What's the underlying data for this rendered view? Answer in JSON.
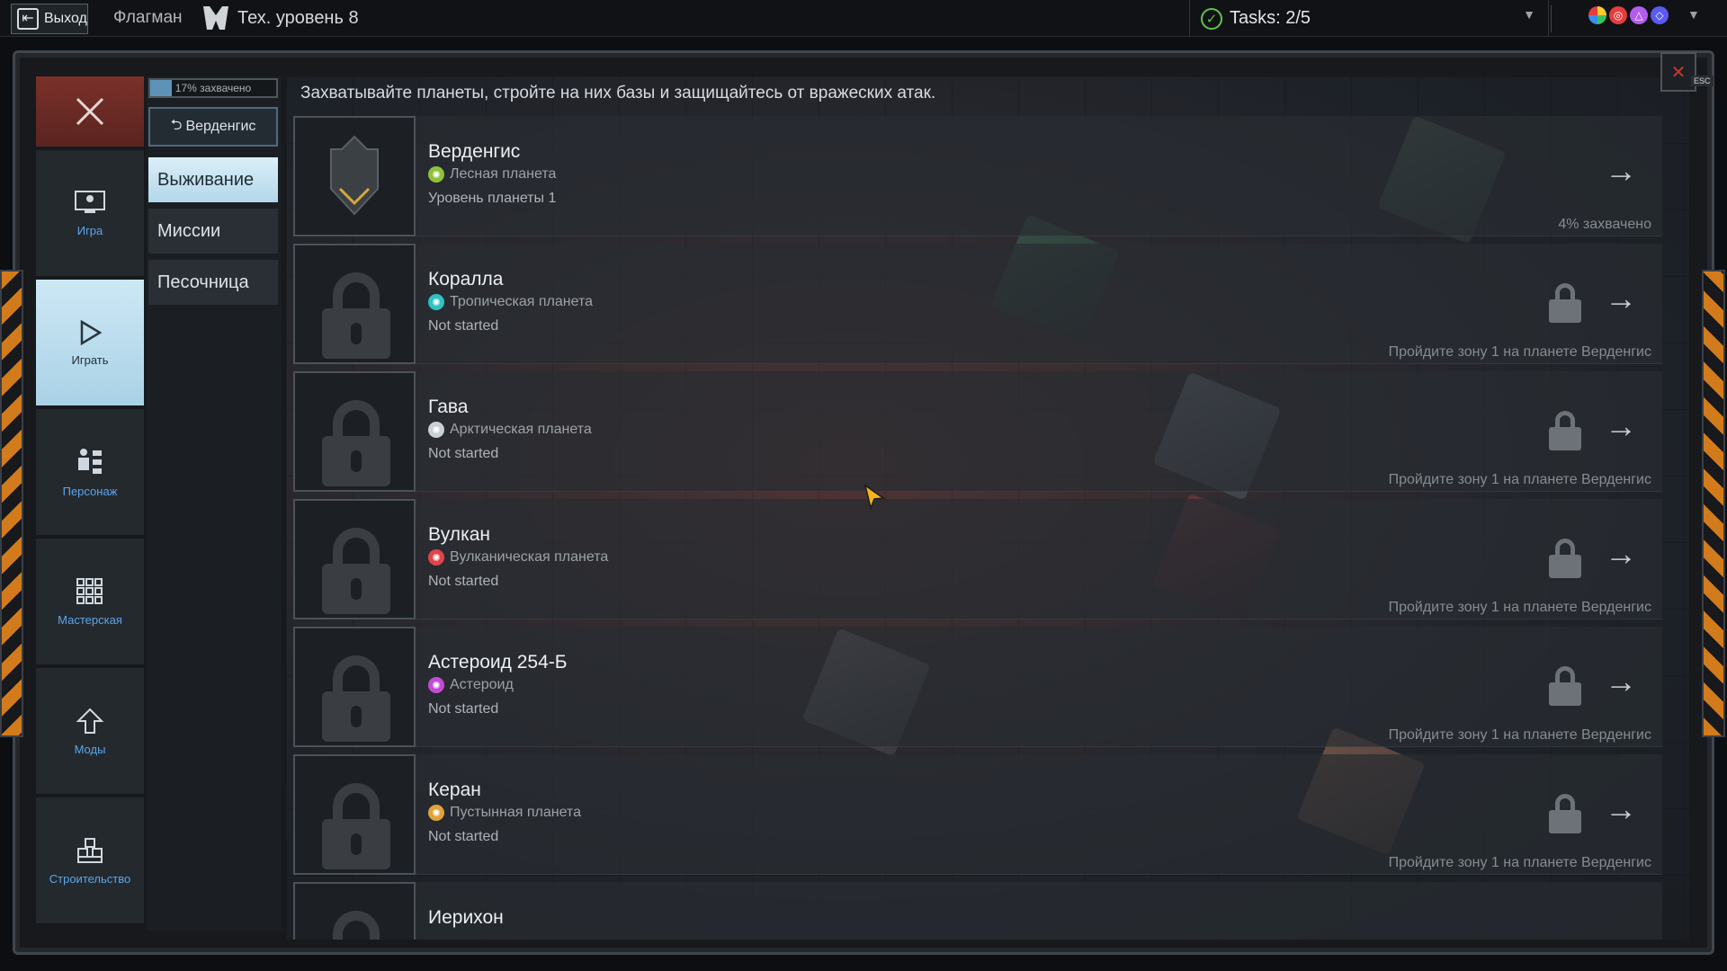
{
  "topbar": {
    "exit_label": "Выход",
    "flagship_label": "Флагман",
    "tech_level": "Тех. уровень 8",
    "tasks": "Tasks: 2/5",
    "resource_colors": [
      "#ffcc33",
      "#e43d3d",
      "#b45cf0",
      "#5a5af0"
    ]
  },
  "nav": {
    "items": [
      {
        "label": "Игра",
        "icon": "monitor-icon"
      },
      {
        "label": "Играть",
        "icon": "play-icon"
      },
      {
        "label": "Персонаж",
        "icon": "character-icon"
      },
      {
        "label": "Мастерская",
        "icon": "grid-icon"
      },
      {
        "label": "Моды",
        "icon": "arrow-up-icon"
      },
      {
        "label": "Строительство",
        "icon": "blocks-icon"
      }
    ],
    "active": "Играть"
  },
  "submenu": {
    "progress_label": "17% захвачено",
    "progress_fraction": 0.17,
    "planet_button": "Верденгис",
    "modes": [
      "Выживание",
      "Миссии",
      "Песочница"
    ],
    "active_mode": "Выживание"
  },
  "main": {
    "description": "Захватывайте планеты, стройте на них базы и защищайтесь от вражеских атак.",
    "planets": [
      {
        "name": "Верденгис",
        "type": "Лесная планета",
        "type_color": "#8fc23a",
        "status": "Уровень планеты 1",
        "note": "4% захвачено",
        "locked": false
      },
      {
        "name": "Коралла",
        "type": "Тропическая планета",
        "type_color": "#2fc2c0",
        "status": "Not started",
        "note": "Пройдите зону 1 на планете Верденгис",
        "locked": true
      },
      {
        "name": "Гава",
        "type": "Арктическая планета",
        "type_color": "#c9d1d6",
        "status": "Not started",
        "note": "Пройдите зону 1 на планете Верденгис",
        "locked": true
      },
      {
        "name": "Вулкан",
        "type": "Вулканическая планета",
        "type_color": "#e0454a",
        "status": "Not started",
        "note": "Пройдите зону 1 на планете Верденгис",
        "locked": true
      },
      {
        "name": "Астероид 254-Б",
        "type": "Астероид",
        "type_color": "#c24cd3",
        "status": "Not started",
        "note": "Пройдите зону 1 на планете Верденгис",
        "locked": true
      },
      {
        "name": "Керан",
        "type": "Пустынная планета",
        "type_color": "#e0a23a",
        "status": "Not started",
        "note": "Пройдите зону 1 на планете Верденгис",
        "locked": true
      },
      {
        "name": "Иерихон",
        "type": "",
        "type_color": "",
        "status": "",
        "note": "",
        "locked": true
      }
    ]
  },
  "esc_label": "ESC"
}
